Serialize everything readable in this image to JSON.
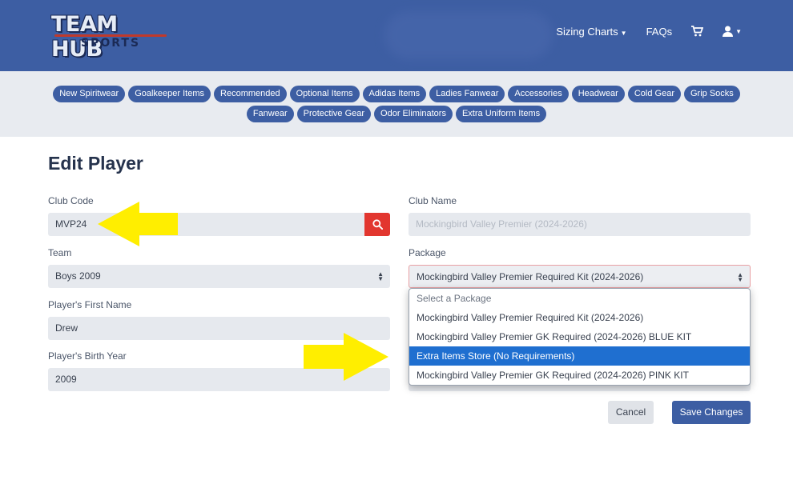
{
  "brand": {
    "line1": "TEAM HUB",
    "line2": "SPORTS"
  },
  "nav": {
    "sizing_charts": "Sizing Charts",
    "faqs": "FAQs"
  },
  "categories_row1": [
    "New Spiritwear",
    "Goalkeeper Items",
    "Recommended",
    "Optional Items",
    "Adidas Items",
    "Ladies Fanwear",
    "Accessories",
    "Headwear",
    "Cold Gear",
    "Grip Socks"
  ],
  "categories_row2": [
    "Fanwear",
    "Protective Gear",
    "Odor Eliminators",
    "Extra Uniform Items"
  ],
  "form": {
    "title": "Edit Player",
    "club_code": {
      "label": "Club Code",
      "value": "MVP24"
    },
    "club_name": {
      "label": "Club Name",
      "value": "Mockingbird Valley Premier (2024-2026)"
    },
    "team": {
      "label": "Team",
      "value": "Boys 2009"
    },
    "package": {
      "label": "Package",
      "value": "Mockingbird Valley Premier Required Kit (2024-2026)",
      "options": [
        "Select a Package",
        "Mockingbird Valley Premier Required Kit (2024-2026)",
        "Mockingbird Valley Premier GK Required (2024-2026) BLUE KIT",
        "Extra Items Store (No Requirements)",
        "Mockingbird Valley Premier GK Required (2024-2026) PINK KIT"
      ],
      "highlighted_option": "Extra Items Store (No Requirements)"
    },
    "first_name": {
      "label": "Player's First Name",
      "value": "Drew"
    },
    "birth_year": {
      "label": "Player's Birth Year",
      "value": "2009"
    }
  },
  "buttons": {
    "cancel": "Cancel",
    "save": "Save Changes"
  },
  "icons": {
    "search": "search-icon",
    "cart": "cart-icon",
    "user": "user-icon"
  },
  "colors": {
    "primary": "#3d5ea3",
    "danger": "#e2362f",
    "highlight": "#1f6fd0",
    "annotation": "#ffee00"
  }
}
